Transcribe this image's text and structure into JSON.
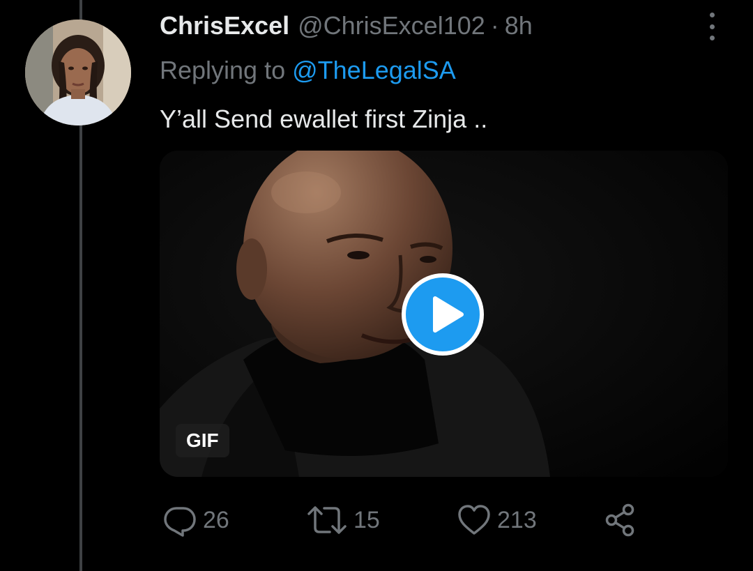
{
  "tweet": {
    "display_name": "ChrisExcel",
    "handle": "@ChrisExcel102",
    "separator": "·",
    "time": "8h",
    "reply_prefix": "Replying to",
    "reply_handle": "@TheLegalSA",
    "text": "Y’all Send ewallet first Zinja ..",
    "media": {
      "badge": "GIF",
      "play_icon": "play-icon"
    },
    "actions": {
      "reply_count": "26",
      "retweet_count": "15",
      "like_count": "213",
      "share_icon": "share-icon"
    }
  },
  "colors": {
    "background": "#000000",
    "text": "#e7e9ea",
    "secondary": "#71767b",
    "accent": "#1d9bf0",
    "thread_line": "#3e4144"
  }
}
